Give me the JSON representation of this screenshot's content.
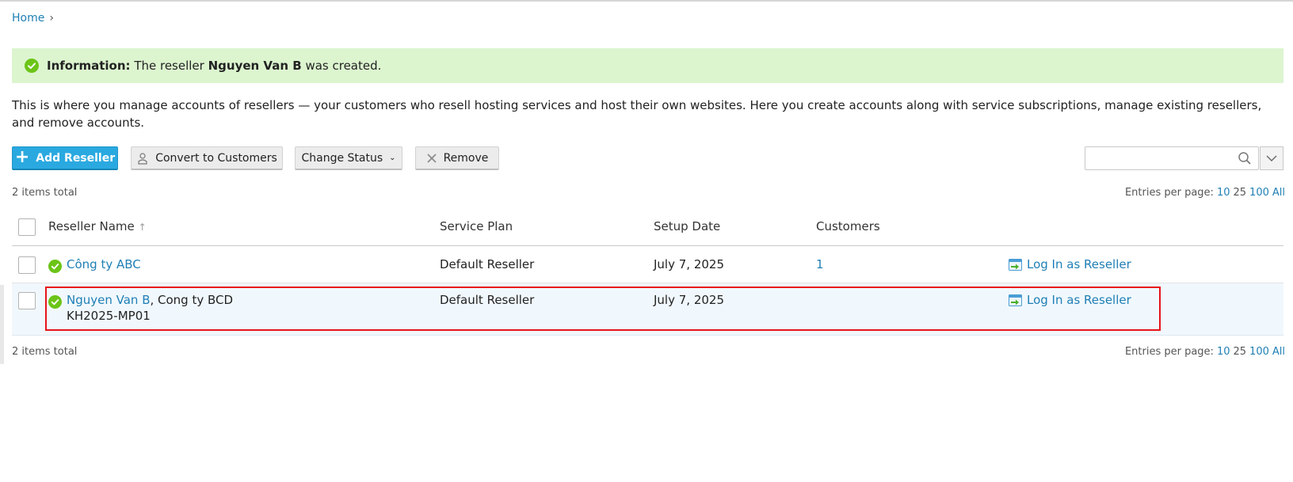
{
  "breadcrumb": {
    "home": "Home"
  },
  "info": {
    "label": "Information:",
    "text_before": " The reseller ",
    "name": "Nguyen Van B",
    "text_after": " was created."
  },
  "description": "This is where you manage accounts of resellers — your customers who resell hosting services and host their own websites. Here you create accounts along with service subscriptions, manage existing resellers, and remove accounts.",
  "toolbar": {
    "add_label": "Add Reseller",
    "convert_label": "Convert to Customers",
    "change_status_label": "Change Status",
    "remove_label": "Remove"
  },
  "search": {
    "value": ""
  },
  "summary": {
    "total": "2 items total",
    "entries_label": "Entries per page:",
    "options": [
      "10",
      "25",
      "100",
      "All"
    ]
  },
  "table": {
    "columns": [
      "Reseller Name",
      "Service Plan",
      "Setup Date",
      "Customers"
    ],
    "sort_indicator": "↑",
    "rows": [
      {
        "name": "Công ty ABC",
        "company": "",
        "login_name": "",
        "plan": "Default Reseller",
        "setup_date": "July 7, 2025",
        "customers": "1",
        "action": "Log In as Reseller"
      },
      {
        "name": "Nguyen Van B",
        "company": ", Cong ty BCD",
        "login_name": "KH2025-MP01",
        "plan": "Default Reseller",
        "setup_date": "July 7, 2025",
        "customers": "",
        "action": "Log In as Reseller"
      }
    ]
  },
  "colors": {
    "accent": "#2aa9e0",
    "link": "#1f7fb5",
    "success_bg": "#dcf5cf",
    "status_ok": "#6cc417",
    "highlight": "#e8131b"
  },
  "icons": [
    "chevron-right-icon",
    "check-circle-icon",
    "plus-icon",
    "user-convert-icon",
    "chevron-down-icon",
    "remove-x-icon",
    "search-icon",
    "login-reseller-icon"
  ]
}
